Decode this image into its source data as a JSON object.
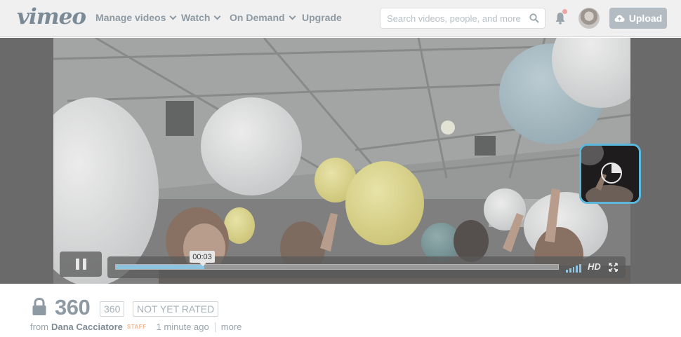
{
  "brand": {
    "logo_text": "vimeo"
  },
  "nav": {
    "items": [
      {
        "label": "Manage videos",
        "has_dropdown": true
      },
      {
        "label": "Watch",
        "has_dropdown": true
      },
      {
        "label": "On Demand",
        "has_dropdown": true
      },
      {
        "label": "Upgrade",
        "has_dropdown": false
      }
    ],
    "search_placeholder": "Search videos, people, and more",
    "upload_label": "Upload"
  },
  "player": {
    "current_time": "00:03",
    "progress_fraction": 0.2,
    "hd_label": "HD",
    "state": "playing"
  },
  "video": {
    "title": "360",
    "badge": "360",
    "rating": "NOT YET RATED",
    "from_label": "from",
    "author": "Dana Cacciatore",
    "author_badge": "STAFF",
    "uploaded": "1 minute ago",
    "more_label": "more"
  },
  "colors": {
    "accent": "#5bb8dc",
    "progress": "#8ec4e0",
    "staff_badge": "#f2b48a",
    "text_muted": "#8e9aa3"
  }
}
